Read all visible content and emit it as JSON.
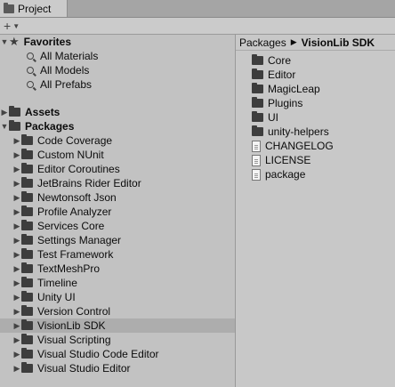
{
  "tab": {
    "label": "Project"
  },
  "toolbar": {
    "add_label": "+"
  },
  "favorites": {
    "label": "Favorites",
    "items": [
      "All Materials",
      "All Models",
      "All Prefabs"
    ]
  },
  "tree": {
    "assets_label": "Assets",
    "packages_label": "Packages",
    "packages": [
      "Code Coverage",
      "Custom NUnit",
      "Editor Coroutines",
      "JetBrains Rider Editor",
      "Newtonsoft Json",
      "Profile Analyzer",
      "Services Core",
      "Settings Manager",
      "Test Framework",
      "TextMeshPro",
      "Timeline",
      "Unity UI",
      "Version Control",
      "VisionLib SDK",
      "Visual Scripting",
      "Visual Studio Code Editor",
      "Visual Studio Editor"
    ],
    "selected": "VisionLib SDK"
  },
  "breadcrumb": {
    "root": "Packages",
    "current": "VisionLib SDK"
  },
  "contents": {
    "folders": [
      "Core",
      "Editor",
      "MagicLeap",
      "Plugins",
      "UI",
      "unity-helpers"
    ],
    "files": [
      "CHANGELOG",
      "LICENSE",
      "package"
    ]
  }
}
